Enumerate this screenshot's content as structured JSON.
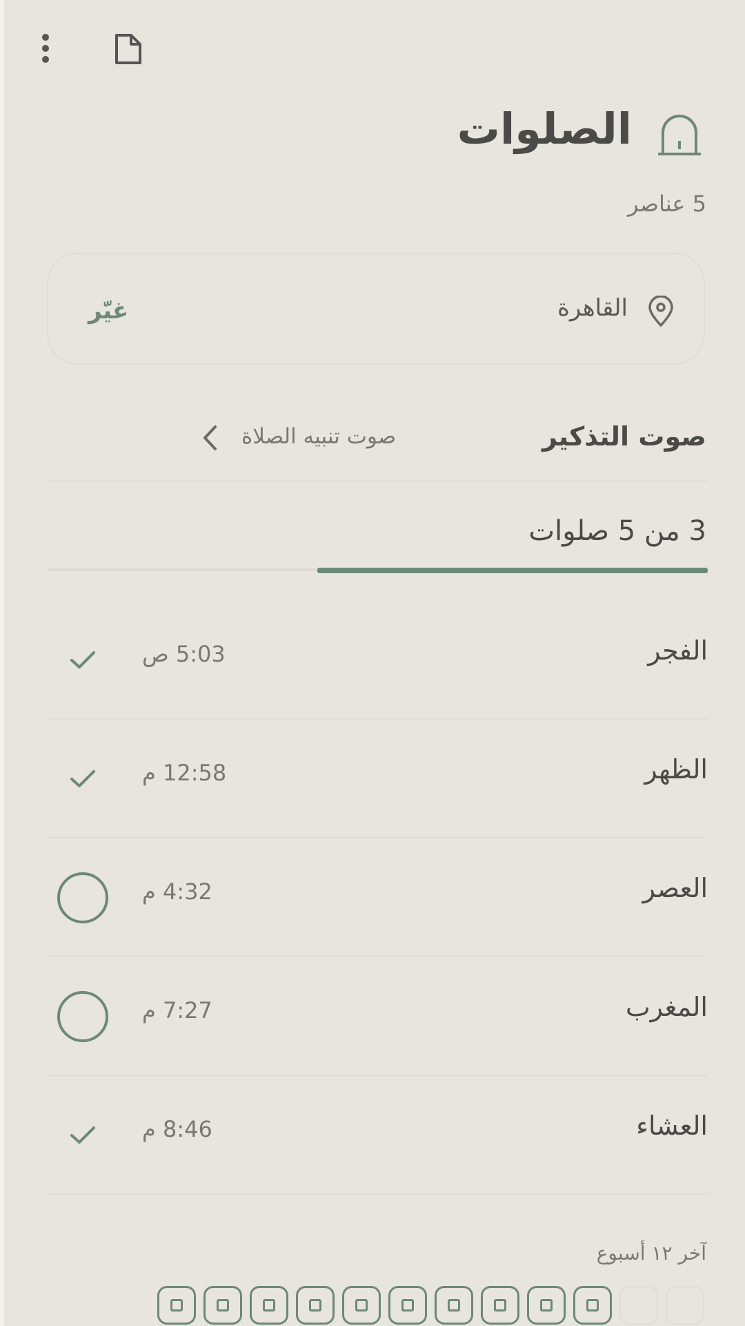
{
  "header": {
    "menu_icon": "more-vert-icon",
    "document_icon": "document-icon",
    "title": "الصلوات",
    "title_icon": "mosque-arch-icon",
    "item_count": "5 عناصر"
  },
  "location": {
    "icon": "location-pin-icon",
    "city": "القاهرة",
    "change_label": "غيّر"
  },
  "reminder": {
    "label": "صوت التذكير",
    "value": "صوت تنبيه الصلاة",
    "chevron_icon": "chevron-left-icon"
  },
  "progress": {
    "label": "3 من 5 صلوات",
    "completed": 3,
    "total": 5
  },
  "prayers": [
    {
      "name": "الفجر",
      "time": "5:03 ص",
      "done": true
    },
    {
      "name": "الظهر",
      "time": "12:58 م",
      "done": true
    },
    {
      "name": "العصر",
      "time": "4:32 م",
      "done": false
    },
    {
      "name": "المغرب",
      "time": "7:27 م",
      "done": false
    },
    {
      "name": "العشاء",
      "time": "8:46 م",
      "done": true
    }
  ],
  "history": {
    "label": "آخر ١٢ أسبوع",
    "weeks_filled": [
      true,
      true,
      true,
      true,
      true,
      true,
      true,
      true,
      true,
      true,
      false,
      false
    ]
  },
  "colors": {
    "background": "#e8e4de",
    "accent": "#6b8a76",
    "text": "#4a4a48",
    "muted": "#7a7873"
  }
}
